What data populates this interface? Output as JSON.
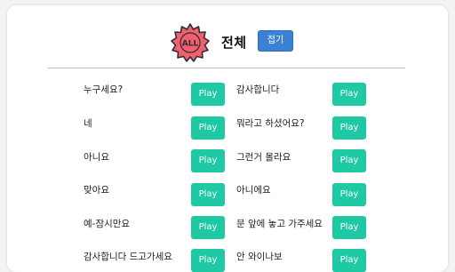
{
  "header": {
    "badge_text": "ALL",
    "title": "전체",
    "collapse_label": "접기"
  },
  "phrases": {
    "left": [
      "누구세요?",
      "네",
      "아니요",
      "맞아요",
      "예-잠시만요",
      "감사합니다 드고가세요"
    ],
    "right": [
      "감사합니다",
      "뭐라고 하셨어요?",
      "그런거 몰라요",
      "아니에요",
      "문 앞에 놓고 가주세요",
      "안 와이나보"
    ]
  },
  "play_label": "Play",
  "colors": {
    "accent_blue": "#3b82d4",
    "play_green": "#1fc9a3",
    "badge_red": "#f2606c"
  }
}
